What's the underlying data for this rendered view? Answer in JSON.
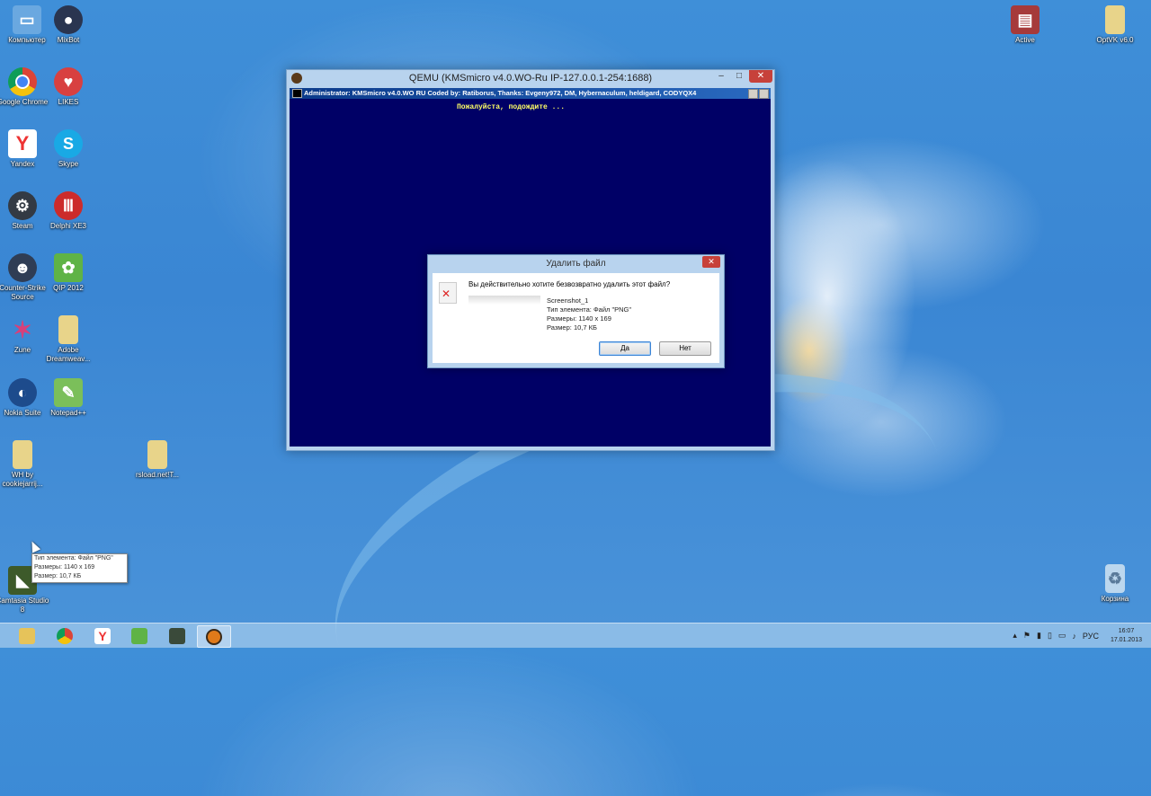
{
  "desktop": {
    "left_column": [
      {
        "label": "Компьютер",
        "icon": "computer-icon",
        "color": "#6aa8e0"
      },
      {
        "label": "MixBot",
        "icon": "user-avatar-icon",
        "color": "#2a3550"
      },
      {
        "label": "Google Chrome",
        "icon": "chrome-icon",
        "color": "#e8e8e8"
      },
      {
        "label": "LIKES",
        "icon": "heart-icon",
        "color": "#d84040"
      },
      {
        "label": "Yandex",
        "icon": "yandex-icon",
        "color": "#e8e8e8"
      },
      {
        "label": "Skype",
        "icon": "skype-icon",
        "color": "#19a9e5"
      },
      {
        "label": "Steam",
        "icon": "steam-icon",
        "color": "#333a44"
      },
      {
        "label": "Delphi XE3",
        "icon": "delphi-icon",
        "color": "#cc2b2b"
      },
      {
        "label": "Counter-Strike Source",
        "icon": "counter-strike-icon",
        "color": "#2f3d55"
      },
      {
        "label": "QIP 2012",
        "icon": "qip-icon",
        "color": "#5fb346"
      },
      {
        "label": "Zune",
        "icon": "zune-icon",
        "color": "#d8407a"
      },
      {
        "label": "Adobe Dreamweav...",
        "icon": "folder-icon",
        "color": "#e8d48a"
      },
      {
        "label": "Nokia Suite",
        "icon": "nokia-icon",
        "color": "#1d4b8c"
      },
      {
        "label": "Notepad++",
        "icon": "notepad-icon",
        "color": "#7bbf5a"
      },
      {
        "label": "WH by cookiejarrij...",
        "icon": "folder-icon",
        "color": "#e8d48a"
      },
      {
        "label": "rsload.net!T...",
        "icon": "folder-icon",
        "color": "#e8d48a"
      },
      {
        "label": "Camtasia Studio 8",
        "icon": "camtasia-icon",
        "color": "#3d5a2a"
      }
    ],
    "right_icons": [
      {
        "label": "Active",
        "icon": "winrar-icon",
        "color": "#a63a3a"
      },
      {
        "label": "OptVK v6.0",
        "icon": "folder-icon",
        "color": "#e8d48a"
      },
      {
        "label": "Корзина",
        "icon": "recycle-bin-icon",
        "color": "#bcd7ee"
      }
    ]
  },
  "qemu": {
    "title": "QEMU (KMSmicro v4.0.WO-Ru IP-127.0.0.1-254:1688)",
    "minimize": "–",
    "maximize": "□",
    "close": "✕",
    "console_title": "Administrator:  KMSmicro v4.0.WO RU Coded by: Ratiborus, Thanks: Evgeny972, DM, Hybernaculum, heldigard, CODYQX4",
    "console_text": "Пожалуйста, подождите ..."
  },
  "dialog": {
    "title": "Удалить файл",
    "close": "✕",
    "question": "Вы действительно хотите безвозвратно удалить этот файл?",
    "file_name": "Screenshot_1",
    "file_type": "Тип элемента: Файл \"PNG\"",
    "dimensions": "Размеры: 1140 x 169",
    "size": "Размер: 10,7 КБ",
    "yes": "Да",
    "no": "Нет"
  },
  "tooltip": {
    "line1": "Тип элемента: Файл \"PNG\"",
    "line2": "Размеры: 1140 x 169",
    "line3": "Размер: 10,7 КБ"
  },
  "taskbar": {
    "apps": [
      {
        "icon": "file-explorer-icon",
        "color": "#e6c35a"
      },
      {
        "icon": "chrome-icon",
        "color": "#d6433a"
      },
      {
        "icon": "yandex-icon",
        "color": "#e33"
      },
      {
        "icon": "qip-icon",
        "color": "#5fb346"
      },
      {
        "icon": "console-icon",
        "color": "#3a4a3a"
      },
      {
        "icon": "qemu-icon",
        "color": "#e07a1a"
      }
    ],
    "language": "РУС",
    "time": "16:07",
    "date": "17.01.2013"
  }
}
